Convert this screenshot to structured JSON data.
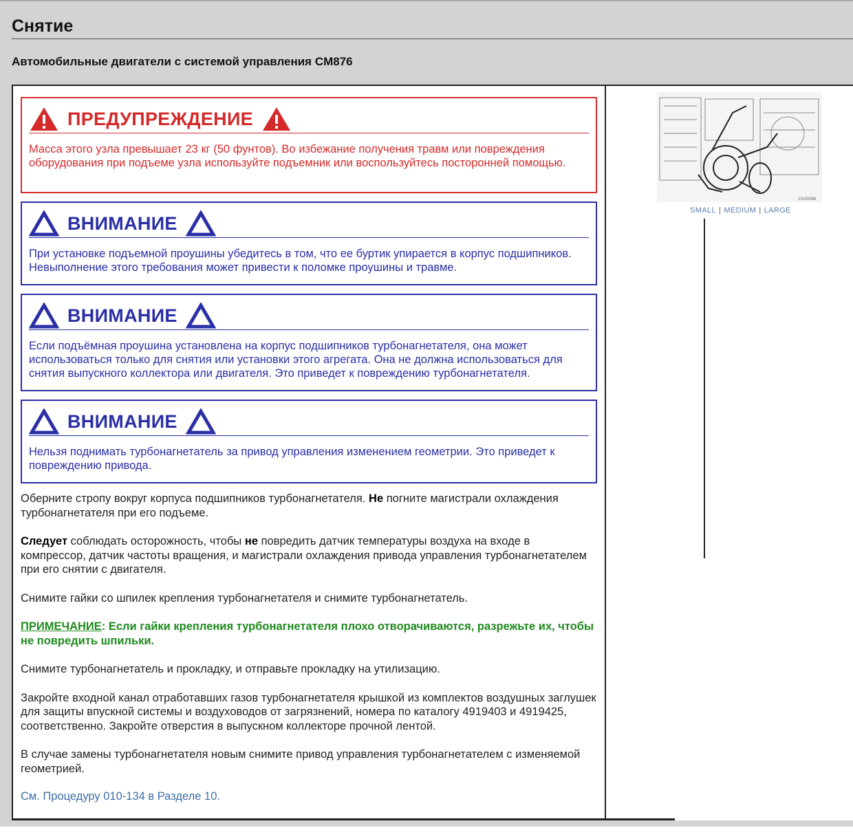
{
  "header": {
    "title": "Снятие",
    "subtitle": "Автомобильные двигатели с системой управления CM876"
  },
  "warning": {
    "title": "ПРЕДУПРЕЖДЕНИЕ",
    "text": "Масса этого узла превышает 23 кг (50 фунтов). Во избежание получения травм или повреждения оборудования при подъеме узла используйте подъемник или воспользуйтесь посторонней помощью."
  },
  "cautions": [
    {
      "title": "ВНИМАНИЕ",
      "text": "При установке подъемной проушины убедитесь в том, что ее буртик упирается в корпус подшипников. Невыполнение этого требования может привести к поломке проушины и травме."
    },
    {
      "title": "ВНИМАНИЕ",
      "text": "Если подъёмная проушина установлена на корпус подшипников турбонагнетателя, она может использоваться только для снятия или установки этого агрегата. Она не должна использоваться для снятия выпускного коллектора или двигателя. Это приведет к повреждению турбонагнетателя."
    },
    {
      "title": "ВНИМАНИЕ",
      "text": "Нельзя поднимать турбонагнетатель за привод управления изменением геометрии. Это приведет к повреждению привода."
    }
  ],
  "steps": {
    "p1_a": "Оберните стропу вокруг корпуса подшипников турбонагнетателя.",
    "p1_b": "Не",
    "p1_c": "погните магистрали охлаждения турбонагнетателя при его подъеме.",
    "p2_a": "Следует",
    "p2_b": "соблюдать осторожность, чтобы",
    "p2_c": "не",
    "p2_d": "повредить датчик температуры воздуха на входе в компрессор, датчик частоты вращения, и магистрали охлаждения привода управления турбонагнетателем при его снятии с двигателя.",
    "p3": "Снимите гайки со шпилек крепления турбонагнетателя и снимите турбонагнетатель.",
    "note_label": "ПРИМЕЧАНИЕ",
    "note_text": ": Если гайки крепления турбонагнетателя плохо отворачиваются, разрежьте их, чтобы не повредить шпильки.",
    "p4": "Снимите турбонагнетатель и прокладку, и отправьте прокладку на утилизацию.",
    "p5": "Закройте входной канал отработавших газов турбонагнетателя крышкой из комплектов воздушных заглушек для защиты впускной системы и воздуховодов от загрязнений, номера по каталогу 4919403 и 4919425, соответственно. Закройте отверстия в выпускном коллекторе прочной лентой.",
    "p6": "В случае замены турбонагнетателя новым снимите привод управления турбонагнетателем с изменяемой геометрией.",
    "ref_link": "См. Процедуру 010-134 в Разделе 10."
  },
  "figure": {
    "caption_code": "10c00066",
    "size_small": "SMALL",
    "size_medium": "MEDIUM",
    "size_large": "LARGE",
    "separator": "|"
  },
  "colors": {
    "warning": "#d42a2a",
    "caution": "#2a2fa6",
    "note": "#1e8a1e",
    "link": "#3d6ea8"
  }
}
